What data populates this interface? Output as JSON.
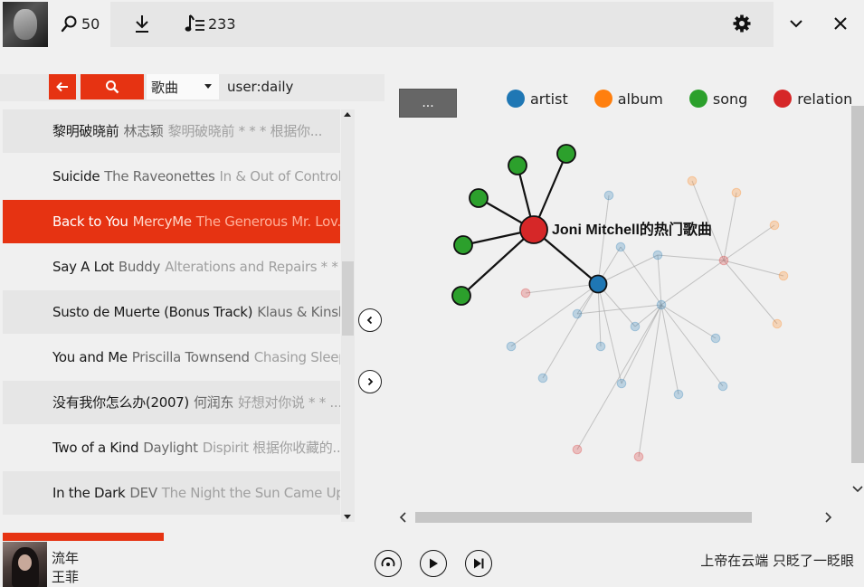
{
  "topbar": {
    "search_count": "50",
    "playlist_count": "233",
    "icons": [
      "search-icon",
      "download-icon",
      "music-list-icon",
      "gear-icon",
      "chevron-down-icon",
      "close-icon"
    ]
  },
  "filter": {
    "type_selected": "歌曲",
    "query": "user:daily"
  },
  "songs": [
    {
      "title": "黎明破晓前",
      "artist": "林志颖",
      "album": "黎明破晓前 * * * 根据你..."
    },
    {
      "title": "Suicide",
      "artist": "The Raveonettes",
      "album": "In & Out of Control * ..."
    },
    {
      "title": "Back to You",
      "artist": "MercyMe",
      "album": "The Generous Mr. Lov... ."
    },
    {
      "title": "Say A Lot",
      "artist": "Buddy",
      "album": "Alterations and Repairs * * 根..."
    },
    {
      "title": "Susto de Muerte (Bonus Track)",
      "artist": "Klaus & Kinski",
      "album": "..."
    },
    {
      "title": "You and Me",
      "artist": "Priscilla Townsend",
      "album": "Chasing Sleep * ..."
    },
    {
      "title": "没有我你怎么办(2007)",
      "artist": "何润东",
      "album": "好想对你说 * * ..."
    },
    {
      "title": "Two of a Kind",
      "artist": "Daylight",
      "album": "Dispirit 根据你收藏的..."
    },
    {
      "title": "In the Dark",
      "artist": "DEV",
      "album": "The Night the Sun Came Up * ..."
    }
  ],
  "selected_song_index": 2,
  "graph": {
    "menu_label": "...",
    "legend": [
      {
        "label": "artist",
        "color": "#1f77b4"
      },
      {
        "label": "album",
        "color": "#ff7f0e"
      },
      {
        "label": "song",
        "color": "#2ca02c"
      },
      {
        "label": "relation",
        "color": "#d62728"
      }
    ],
    "center_label": "Joni Mitchell的热门歌曲"
  },
  "player": {
    "title": "流年",
    "artist": "王菲",
    "lyric": "上帝在云端 只眨了一眨眼"
  },
  "colors": {
    "accent": "#e63312"
  }
}
